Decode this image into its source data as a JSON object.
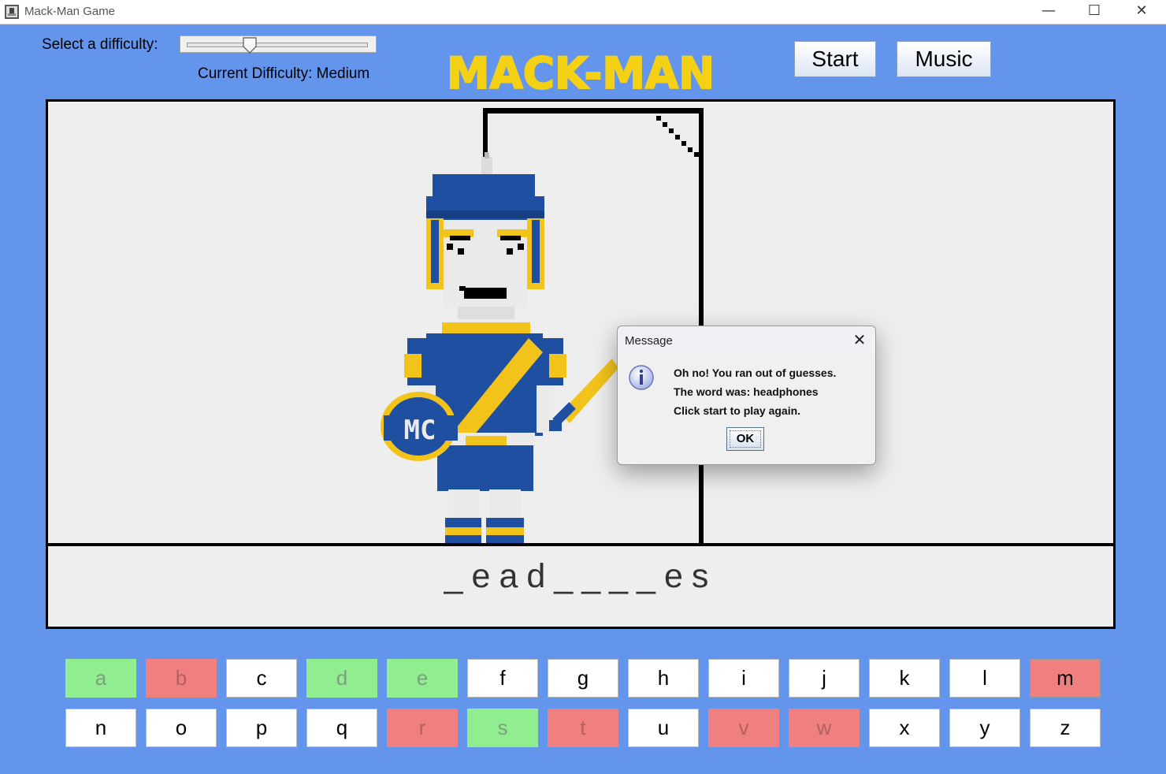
{
  "window": {
    "title": "Mack-Man Game",
    "minimize": "—",
    "maximize": "☐",
    "close": "✕"
  },
  "header": {
    "difficulty_label": "Select a difficulty:",
    "slider_value_fraction": 0.33,
    "current_difficulty": "Current Difficulty: Medium",
    "logo_text": "MACK-MAN",
    "start_label": "Start",
    "music_label": "Music"
  },
  "game": {
    "word_display": "_ead____es"
  },
  "keyboard": {
    "row1": [
      {
        "letter": "a",
        "state": "correct"
      },
      {
        "letter": "b",
        "state": "wrong"
      },
      {
        "letter": "c",
        "state": "unused"
      },
      {
        "letter": "d",
        "state": "correct"
      },
      {
        "letter": "e",
        "state": "correct"
      },
      {
        "letter": "f",
        "state": "unused"
      },
      {
        "letter": "g",
        "state": "unused"
      },
      {
        "letter": "h",
        "state": "unused"
      },
      {
        "letter": "i",
        "state": "unused"
      },
      {
        "letter": "j",
        "state": "unused"
      },
      {
        "letter": "k",
        "state": "unused"
      },
      {
        "letter": "l",
        "state": "unused"
      },
      {
        "letter": "m",
        "state": "wrong-last"
      }
    ],
    "row2": [
      {
        "letter": "n",
        "state": "unused"
      },
      {
        "letter": "o",
        "state": "unused"
      },
      {
        "letter": "p",
        "state": "unused"
      },
      {
        "letter": "q",
        "state": "unused"
      },
      {
        "letter": "r",
        "state": "wrong"
      },
      {
        "letter": "s",
        "state": "correct"
      },
      {
        "letter": "t",
        "state": "wrong"
      },
      {
        "letter": "u",
        "state": "unused"
      },
      {
        "letter": "v",
        "state": "wrong"
      },
      {
        "letter": "w",
        "state": "wrong"
      },
      {
        "letter": "x",
        "state": "unused"
      },
      {
        "letter": "y",
        "state": "unused"
      },
      {
        "letter": "z",
        "state": "unused"
      }
    ]
  },
  "dialog": {
    "title": "Message",
    "line1": "Oh no! You ran out of guesses.",
    "line2": "The word was: headphones",
    "line3": "Click start to play again.",
    "ok_label": "OK",
    "close_glyph": "✕"
  },
  "icons": [
    "app-icon",
    "minimize-icon",
    "maximize-icon",
    "close-icon",
    "info-icon",
    "dialog-close-icon"
  ],
  "colors": {
    "background": "#6495ed",
    "panel": "#eeeeee",
    "logo_yellow": "#f5d116",
    "correct_key": "#90ee90",
    "wrong_key": "#f08080",
    "mascot_blue": "#1e4fa0",
    "mascot_gold": "#f2c31b"
  }
}
